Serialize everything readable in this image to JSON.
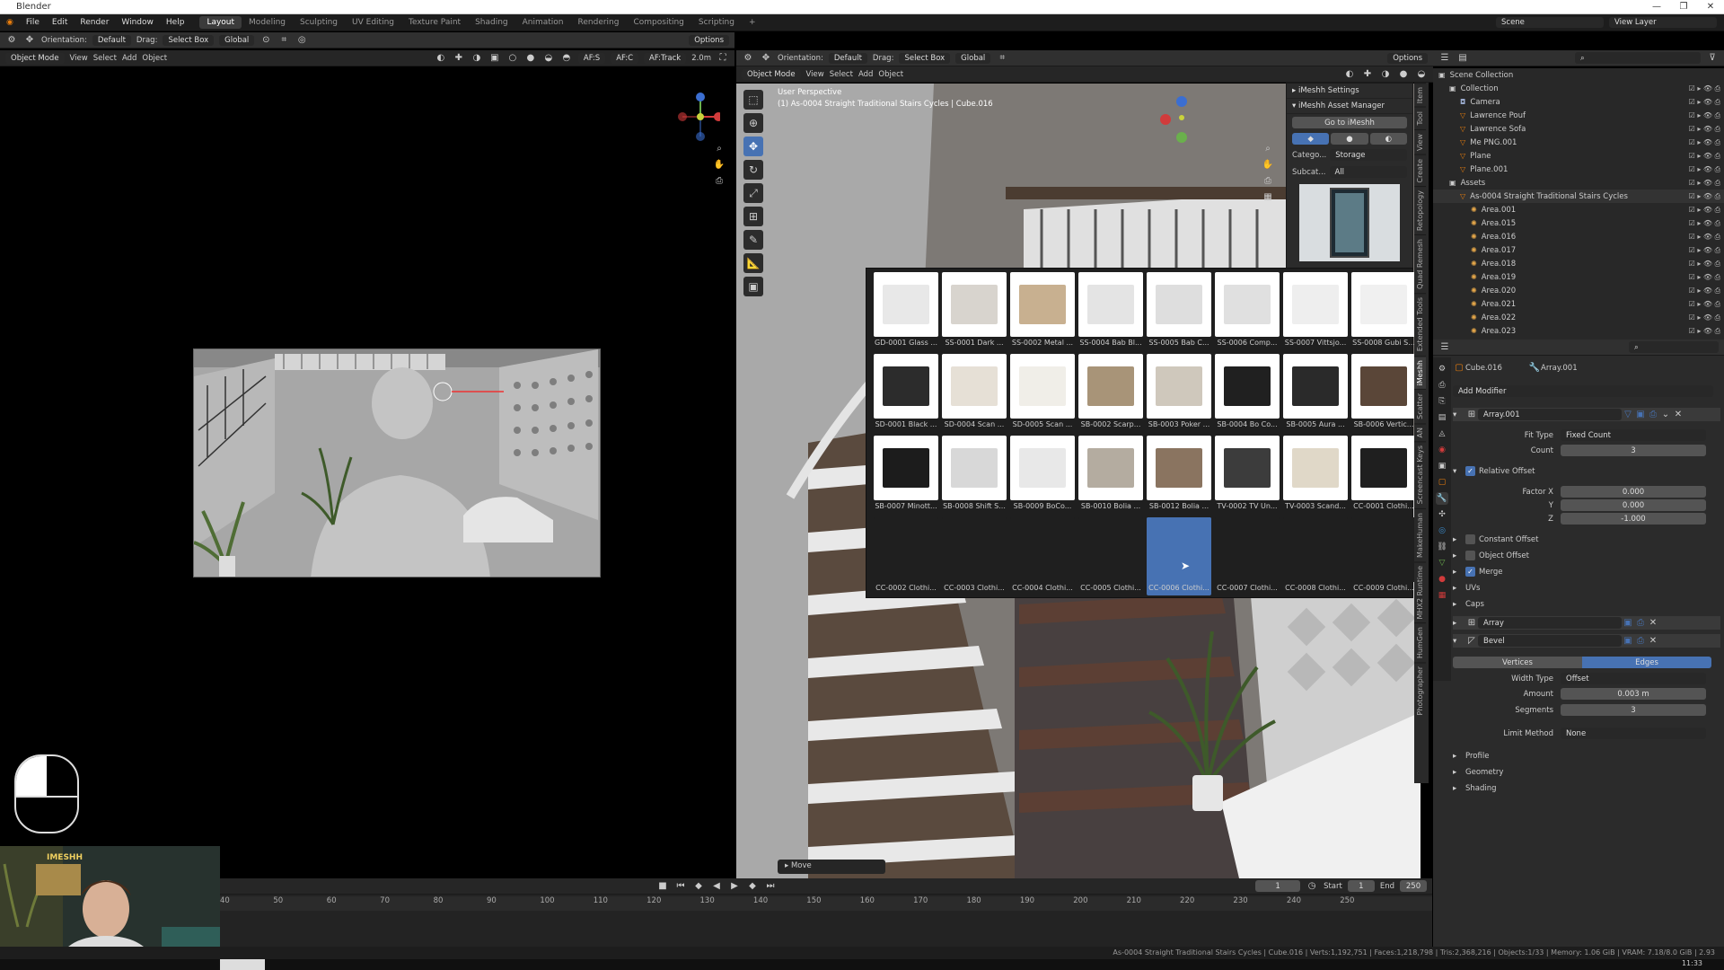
{
  "app": {
    "title": "Blender"
  },
  "menu": {
    "items": [
      "File",
      "Edit",
      "Render",
      "Window",
      "Help"
    ],
    "workspaces": [
      "Layout",
      "Modeling",
      "Sculpting",
      "UV Editing",
      "Texture Paint",
      "Shading",
      "Animation",
      "Rendering",
      "Compositing",
      "Scripting",
      "+"
    ],
    "active_workspace": "Layout",
    "scene": "Scene",
    "view_layer": "View Layer"
  },
  "left_header": {
    "orientation_label": "Orientation:",
    "orientation": "Default",
    "drag_label": "Drag:",
    "drag": "Select Box",
    "transform": "Global",
    "options": "Options",
    "mode": "Object Mode",
    "view": "View",
    "select": "Select",
    "add": "Add",
    "object": "Object",
    "af_s": "AF:S",
    "af_c": "AF:C",
    "af_track": "AF:Track",
    "distance": "2.0m"
  },
  "right_header": {
    "orientation_label": "Orientation:",
    "orientation": "Default",
    "drag_label": "Drag:",
    "drag": "Select Box",
    "transform": "Global",
    "options": "Options",
    "mode": "Object Mode",
    "view": "View",
    "select": "Select",
    "add": "Add",
    "object": "Object"
  },
  "viewport": {
    "perspective": "User Perspective",
    "object_info": "(1) As-0004 Straight Traditional Stairs Cycles | Cube.016",
    "last_op": "Move"
  },
  "imeshh": {
    "settings": "iMeshh Settings",
    "manager": "iMeshh Asset Manager",
    "goto": "Go to iMeshh",
    "category_label": "Catego...",
    "category": "Storage",
    "subcat_label": "Subcat...",
    "subcat": "All"
  },
  "assets": [
    "GD-0001 Glass ...",
    "SS-0001 Dark ...",
    "SS-0002 Metal ...",
    "SS-0004 Bab Bl...",
    "SS-0005 Bab C...",
    "SS-0006 Comp...",
    "SS-0007 Vittsjo...",
    "SS-0008 Gubi S...",
    "SD-0001 Black ...",
    "SD-0004 Scan ...",
    "SD-0005 Scan ...",
    "SB-0002 Scarp...",
    "SB-0003 Poker ...",
    "SB-0004 Bo Co...",
    "SB-0005 Aura ...",
    "SB-0006 Vertic...",
    "SB-0007 Minott...",
    "SB-0008 Shift S...",
    "SB-0009 BoCo...",
    "SB-0010 Bolia ...",
    "SB-0012 Bolia ...",
    "TV-0002 TV Un...",
    "TV-0003 Scand...",
    "CC-0001 Clothi...",
    "CC-0002 Clothi...",
    "CC-0003 Clothi...",
    "CC-0004 Clothi...",
    "CC-0005 Clothi...",
    "CC-0006 Clothi...",
    "CC-0007 Clothi...",
    "CC-0008 Clothi...",
    "CC-0009 Clothi..."
  ],
  "selected_asset_index": 28,
  "side_tabs": [
    "Item",
    "Tool",
    "View",
    "Create",
    "Retopology",
    "Quad Remesh",
    "Extended Tools",
    "iMeshh",
    "Scatter",
    "AN",
    "Screencast Keys",
    "MakeHuman",
    "MHX2 Runtime",
    "HumGen",
    "Photographer"
  ],
  "outliner": {
    "search_placeholder": "",
    "rows": [
      {
        "label": "Scene Collection",
        "indent": 0
      },
      {
        "label": "Collection",
        "indent": 1
      },
      {
        "label": "Camera",
        "indent": 2
      },
      {
        "label": "Lawrence Pouf",
        "indent": 2
      },
      {
        "label": "Lawrence Sofa",
        "indent": 2
      },
      {
        "label": "Me PNG.001",
        "indent": 2
      },
      {
        "label": "Plane",
        "indent": 2
      },
      {
        "label": "Plane.001",
        "indent": 2
      },
      {
        "label": "Assets",
        "indent": 1
      },
      {
        "label": "As-0004 Straight Traditional Stairs Cycles",
        "indent": 2
      },
      {
        "label": "Area.001",
        "indent": 3
      },
      {
        "label": "Area.015",
        "indent": 3
      },
      {
        "label": "Area.016",
        "indent": 3
      },
      {
        "label": "Area.017",
        "indent": 3
      },
      {
        "label": "Area.018",
        "indent": 3
      },
      {
        "label": "Area.019",
        "indent": 3
      },
      {
        "label": "Area.020",
        "indent": 3
      },
      {
        "label": "Area.021",
        "indent": 3
      },
      {
        "label": "Area.022",
        "indent": 3
      },
      {
        "label": "Area.023",
        "indent": 3
      }
    ]
  },
  "properties": {
    "object": "Cube.016",
    "modifier_ref": "Array.001",
    "add_modifier": "Add Modifier",
    "mod1_name": "Array.001",
    "fit_type_label": "Fit Type",
    "fit_type": "Fixed Count",
    "count_label": "Count",
    "count": "3",
    "relative_offset": "Relative Offset",
    "factor_x_label": "Factor X",
    "factor_x": "0.000",
    "y_label": "Y",
    "factor_y": "0.000",
    "z_label": "Z",
    "factor_z": "-1.000",
    "constant_offset": "Constant Offset",
    "object_offset": "Object Offset",
    "merge": "Merge",
    "uvs": "UVs",
    "caps": "Caps",
    "mod2_name": "Array",
    "mod3_name": "Bevel",
    "vertices": "Vertices",
    "edges": "Edges",
    "width_type_label": "Width Type",
    "width_type": "Offset",
    "amount_label": "Amount",
    "amount": "0.003 m",
    "segments_label": "Segments",
    "segments": "3",
    "limit_method_label": "Limit Method",
    "limit_method": "None",
    "profile": "Profile",
    "geometry": "Geometry",
    "shading": "Shading"
  },
  "timeline": {
    "current_frame": "1",
    "start_label": "Start",
    "start": "1",
    "end_label": "End",
    "end": "250",
    "ticks": [
      "40",
      "50",
      "60",
      "70",
      "80",
      "90",
      "100",
      "110",
      "120",
      "130",
      "140",
      "150",
      "160",
      "170",
      "180",
      "190",
      "200",
      "210",
      "220",
      "230",
      "240",
      "250"
    ]
  },
  "status": {
    "text": "As-0004 Straight Traditional Stairs Cycles | Cube.016 | Verts:1,192,751 | Faces:1,218,798 | Tris:2,368,216 | Objects:1/33 | Memory: 1.06 GiB | VRAM: 7.18/8.0 GiB | 2.93"
  },
  "taskbar": {
    "clock": "11:33"
  },
  "webcam": {
    "logo": "IMESHH"
  },
  "colors": {
    "accent": "#4772b3",
    "bg_panel": "#2b2b2b",
    "bg_header": "#303030"
  }
}
